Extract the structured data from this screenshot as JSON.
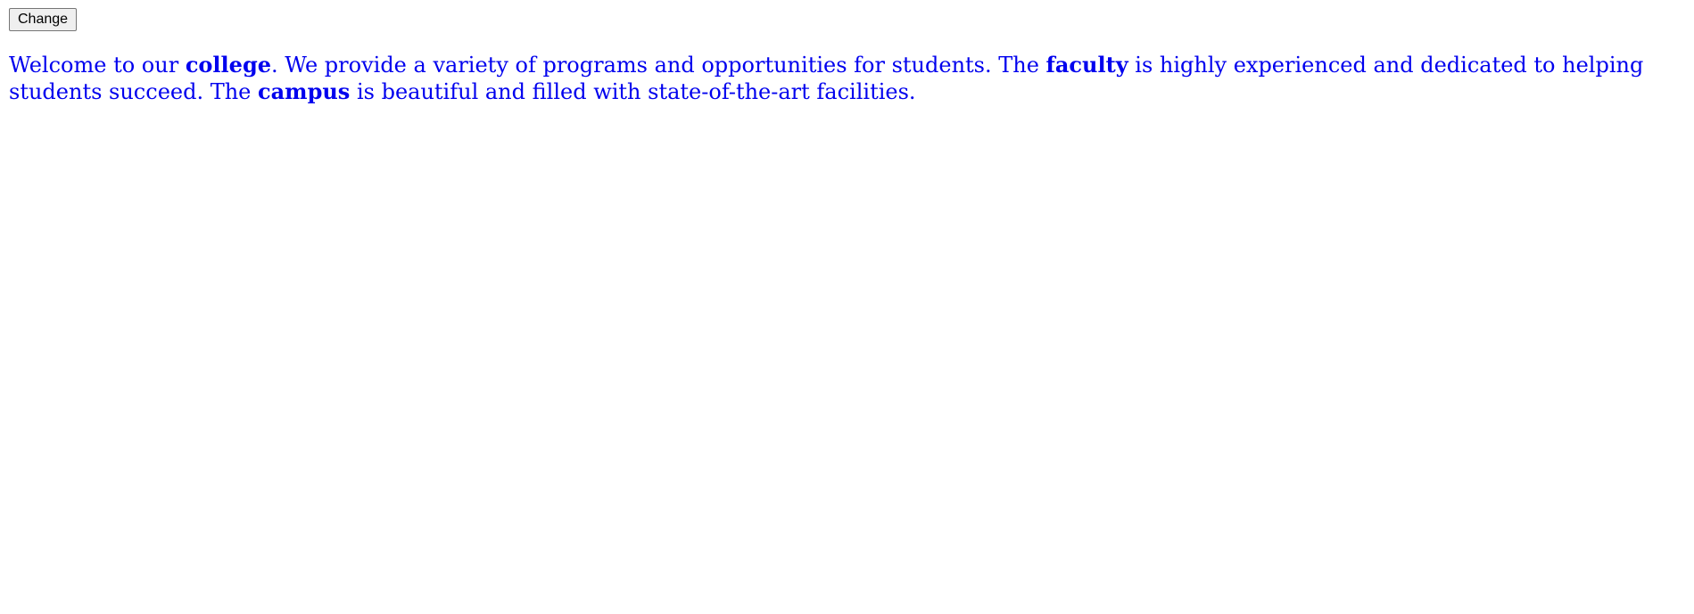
{
  "toolbar": {
    "change_label": "Change"
  },
  "intro": {
    "text_1": "Welcome to our ",
    "keyword_1": "college",
    "text_2": ". We provide a variety of programs and opportunities for students. The ",
    "keyword_2": "faculty",
    "text_3": " is highly experienced and dedicated to helping students succeed. The ",
    "keyword_3": "campus",
    "text_4": " is beautiful and filled with state-of-the-art facilities."
  },
  "colors": {
    "text": "#0000ee",
    "background": "#ffffff",
    "button_bg": "#efefef"
  }
}
